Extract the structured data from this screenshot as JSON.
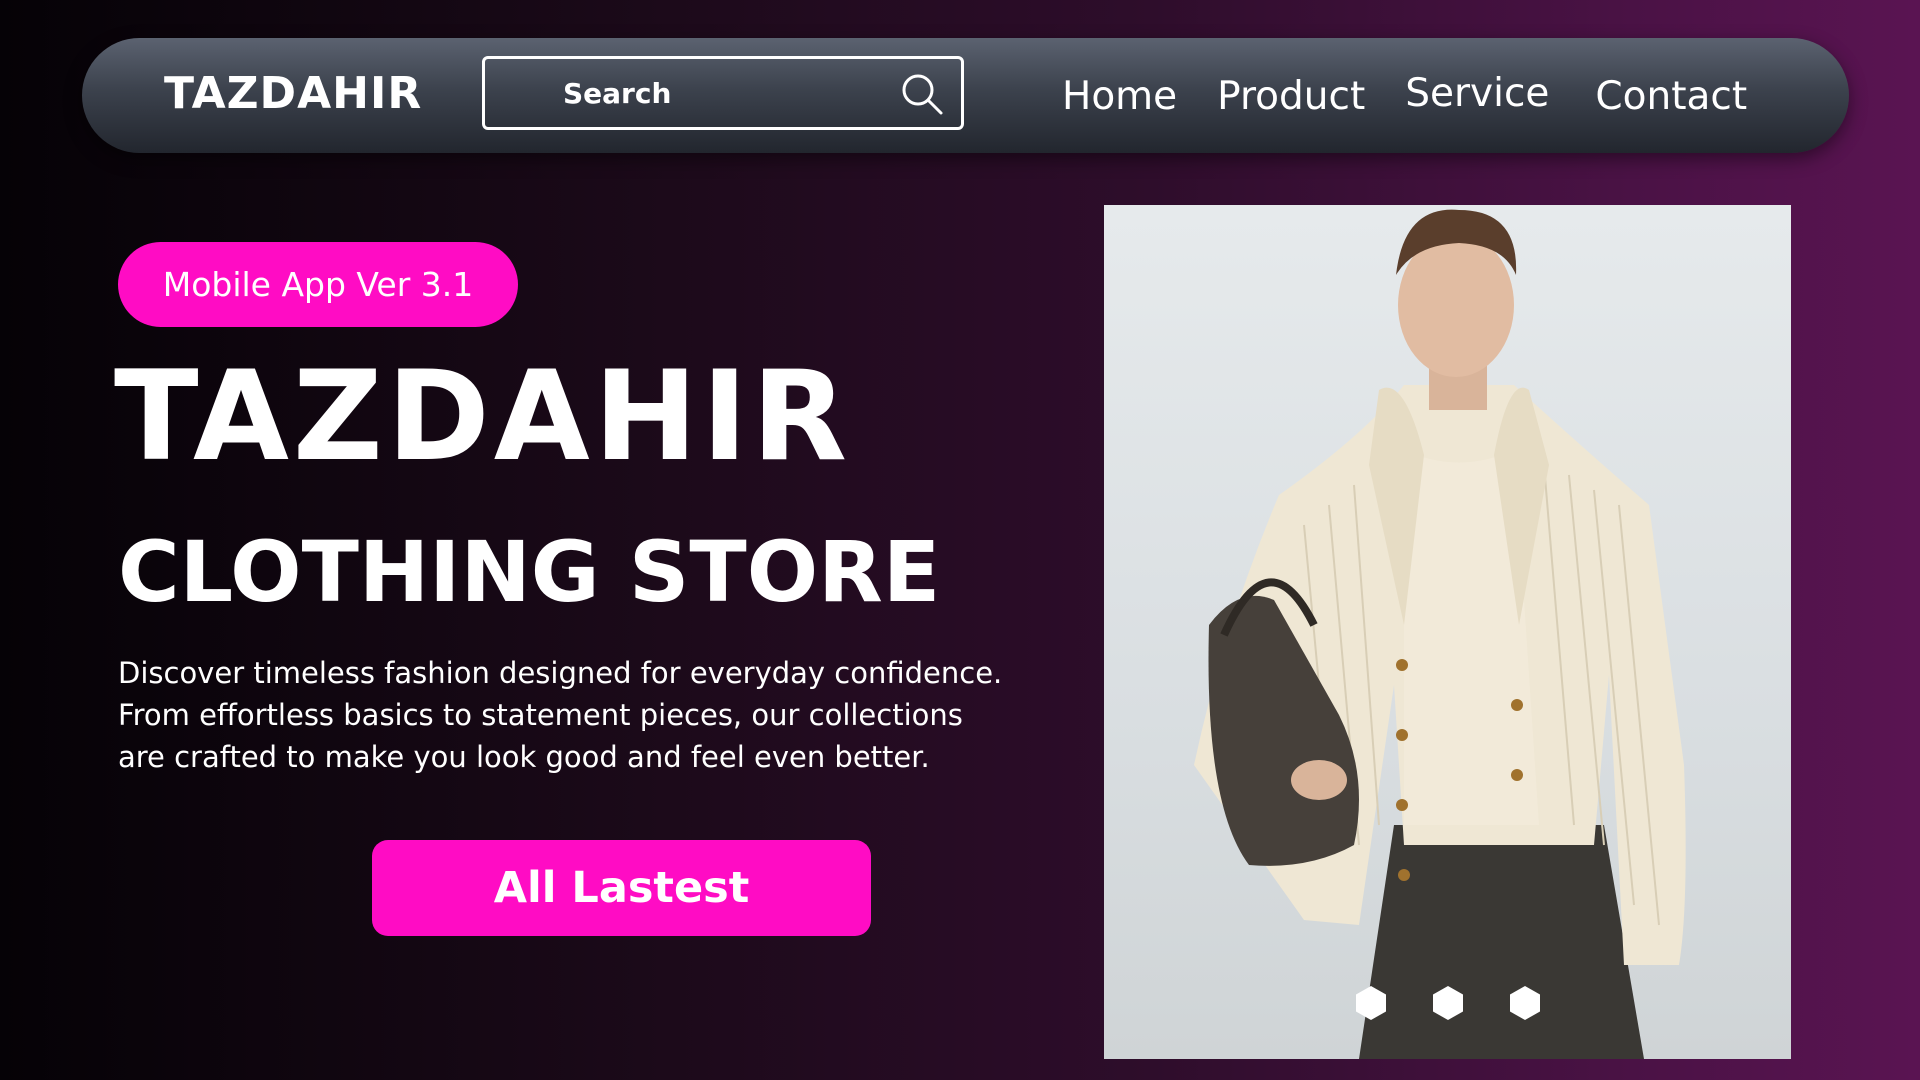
{
  "navbar": {
    "brand": "TAZDAHIR",
    "search": {
      "placeholder": "Search"
    },
    "links": [
      "Home",
      "Product",
      "Service",
      "Contact"
    ]
  },
  "hero": {
    "version_badge": "Mobile App Ver 3.1",
    "title": "TAZDAHIR",
    "subtitle": "CLOTHING STORE",
    "description_lines": [
      "Discover timeless fashion designed for everyday confidence.",
      "From effortless basics to statement pieces, our collections",
      "are crafted to make you look good and feel even better."
    ],
    "cta_label": "All Lastest"
  },
  "image": {
    "subject": "model wearing cream knit cardigan holding dark leather bag"
  },
  "carousel": {
    "dot_count": 3,
    "active_index": 0
  },
  "colors": {
    "accent_pink": "#ff0cc4",
    "navbar_gradient_top": "#5b6270",
    "navbar_gradient_bottom": "#22262e",
    "background_left": "#050206",
    "background_right": "#5a1452",
    "text": "#ffffff"
  },
  "icons": {
    "search": "search-icon",
    "carousel_dot": "hexagon-dot-icon"
  }
}
